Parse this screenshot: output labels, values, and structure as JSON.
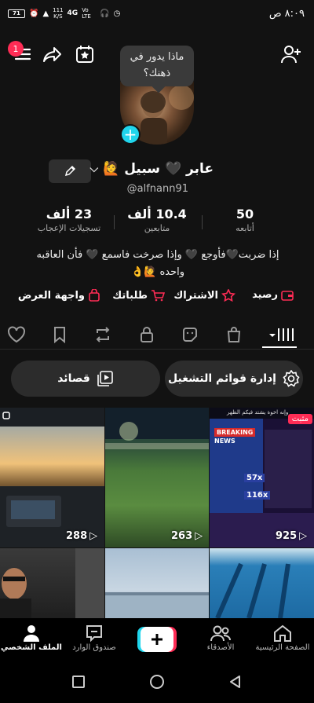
{
  "status": {
    "time": "٨:٠٩ ص",
    "battery": "71",
    "network": "4G",
    "volte": "Vo LTE",
    "speed_top": "111",
    "speed_bottom": "K/S"
  },
  "notifications_badge": "1",
  "thought_bubble": "ماذا يدور في ذهنك؟",
  "profile": {
    "name": "عابر 🖤 سبيل 🙋",
    "handle": "@alfnann91"
  },
  "stats": [
    {
      "value": "50",
      "label": "أتابعه"
    },
    {
      "value": "10.4 ألف",
      "label": "متابعين"
    },
    {
      "value": "23 ألف",
      "label": "تسجيلات الإعجاب"
    }
  ],
  "bio": "إذا ضربت🖤فأوجع 🖤 وإذا صرخت فاسمع 🖤 فأن العاقبه واحده 🙋👌",
  "links": {
    "balance": "رصيد",
    "subscription": "الاشتراك",
    "orders": "طلباتك",
    "showcase": "واجهة العرض"
  },
  "pills": {
    "playlists": "إدارة قوائم التشغيل",
    "poems": "قصائد"
  },
  "videos": [
    {
      "views": "288"
    },
    {
      "views": "263"
    },
    {
      "views": "925",
      "pinned_label": "مثبت"
    },
    {
      "views": ""
    },
    {
      "views": ""
    },
    {
      "views": ""
    }
  ],
  "video_overlay": {
    "breaking": "BREAKING",
    "news": "NEWS",
    "count_a": "57x",
    "count_b": "116x",
    "header": "وإنه اخوة يشتد فيكم الظهر"
  },
  "bottom_nav": {
    "home": "الصفحة الرئيسية",
    "friends": "الأصدقاء",
    "inbox": "صندوق الوارد",
    "profile": "الملف الشخصي"
  },
  "colors": {
    "accent": "#fe2c55",
    "cyan": "#20d5ec",
    "background": "#121212"
  }
}
